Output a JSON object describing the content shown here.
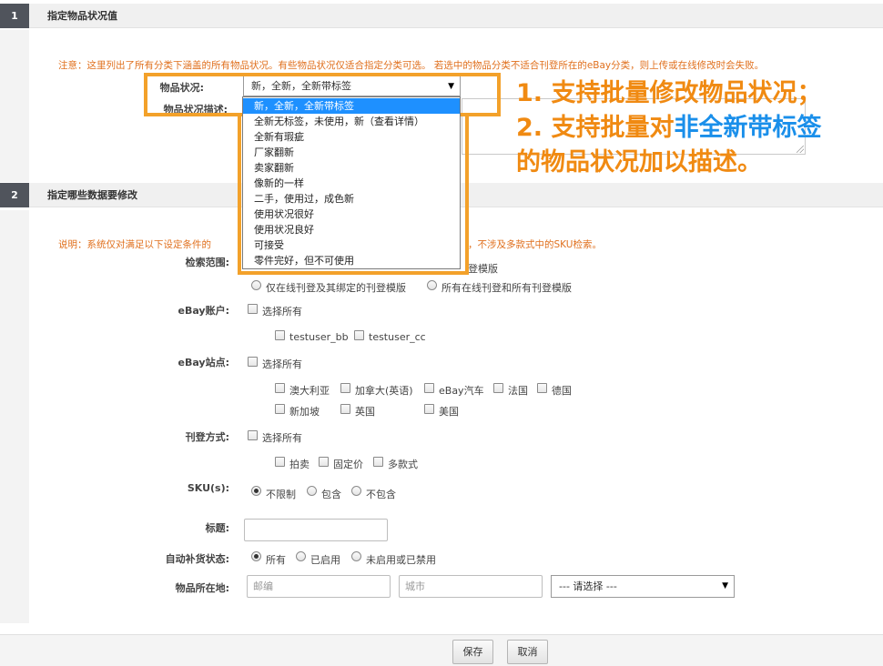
{
  "section1": {
    "number": "1",
    "title": "指定物品状况值",
    "notice": "注意：这里列出了所有分类下涵盖的所有物品状况。有些物品状况仅适合指定分类可选。 若选中的物品分类不适合刊登所在的eBay分类，则上传或在线修改时会失败。",
    "condition_label": "物品状况:",
    "condition_selected": "新，全新，全新带标签",
    "desc_label": "物品状况描述:",
    "dropdown_options": [
      "新，全新，全新带标签",
      "全新无标签，未使用，新（查看详情）",
      "全新有瑕疵",
      "厂家翻新",
      "卖家翻新",
      "像新的一样",
      "二手，使用过，成色新",
      "使用状况很好",
      "使用状况良好",
      "可接受",
      "零件完好，但不可使用"
    ]
  },
  "section2": {
    "number": "2",
    "title": "指定哪些数据要修改",
    "notice_left": "说明：系统仅对满足以下设定条件的",
    "notice_right": "，不涉及多款式中的SKU检索。",
    "search_scope_label": "检索范围:",
    "search_scope_hidden_option": "登模版",
    "search_scope_options": [
      "仅在线刊登及其绑定的刊登模版",
      "所有在线刊登和所有刊登模版"
    ],
    "ebay_account_label": "eBay账户:",
    "select_all": "选择所有",
    "accounts": [
      "testuser_bb",
      "testuser_cc"
    ],
    "ebay_site_label": "eBay站点:",
    "sites_row1": [
      "澳大利亚",
      "加拿大(英语)",
      "eBay汽车",
      "法国",
      "德国"
    ],
    "sites_row2": [
      "新加坡",
      "英国",
      "美国"
    ],
    "listing_type_label": "刊登方式:",
    "listing_types": [
      "拍卖",
      "固定价",
      "多款式"
    ],
    "sku_label": "SKU(s):",
    "sku_options": [
      "不限制",
      "包含",
      "不包含"
    ],
    "title_label": "标题:",
    "restock_label": "自动补货状态:",
    "restock_options": [
      "所有",
      "已启用",
      "未启用或已禁用"
    ],
    "location_label": "物品所在地:",
    "zip_placeholder": "邮编",
    "city_placeholder": "城市",
    "region_select": "--- 请选择 ---"
  },
  "annotation": {
    "line1": "1. 支持批量修改物品状况；",
    "line2_prefix": "2. 支持批量对",
    "line2_highlight": "非全新带标签",
    "line3": "的物品状况加以描述。"
  },
  "footer": {
    "save": "保存",
    "cancel": "取消"
  },
  "colors": {
    "notice": "#e0701e",
    "highlight_border": "#f3a12a",
    "annotation": "#f08a12",
    "annotation_blue": "#1a8fea",
    "dropdown_selected": "#1e90ff"
  }
}
